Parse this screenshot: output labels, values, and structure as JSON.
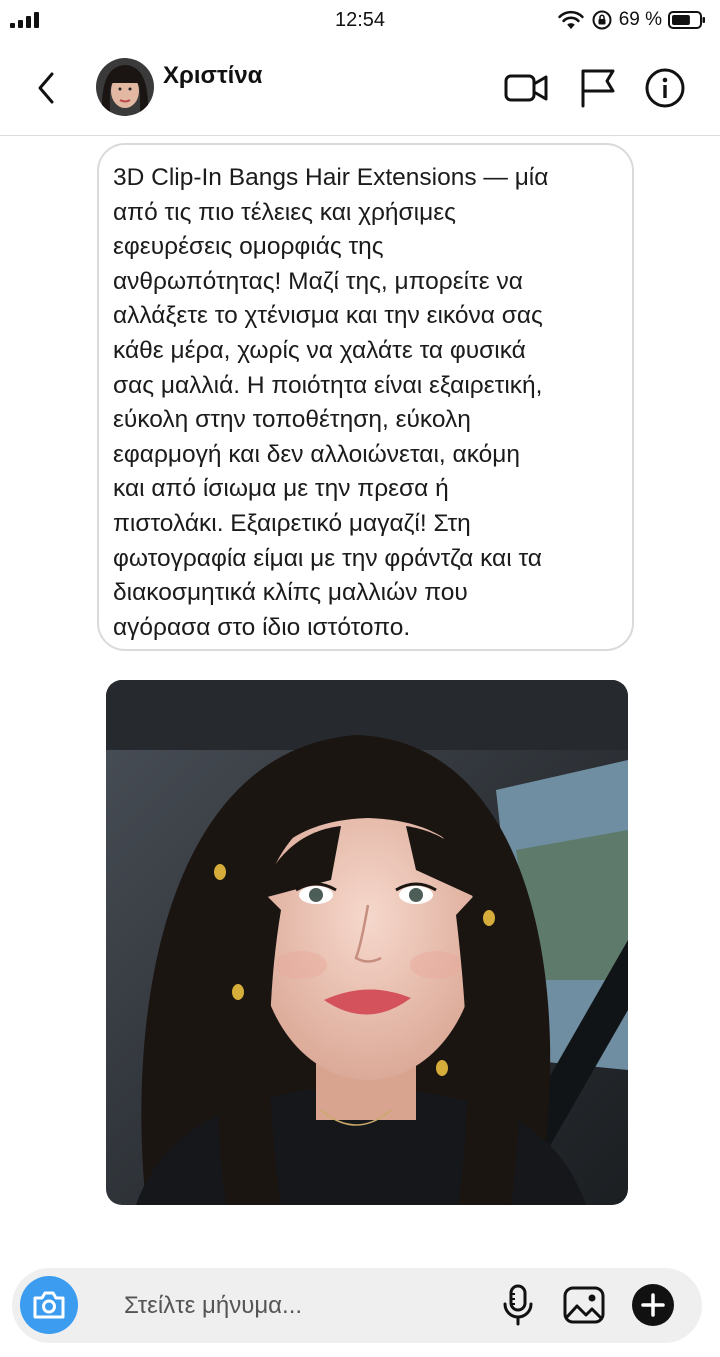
{
  "status_bar": {
    "time": "12:54",
    "battery_percent": "69 %",
    "battery_level": 0.69,
    "icons": [
      "signal-icon",
      "wifi-icon",
      "rotation-lock-icon",
      "battery-icon"
    ]
  },
  "header": {
    "contact_name": "Χριστίνα",
    "icons": [
      "back-icon",
      "video-call-icon",
      "flag-icon",
      "info-icon"
    ]
  },
  "message": {
    "text": "3D Clip-In Bangs Hair Extensions — μία\nαπό τις πιο τέλειες και χρήσιμες\nεφευρέσεις ομορφιάς της\nανθρωπότητας! Μαζί της, μπορείτε να\nαλλάξετε το χτένισμα και την εικόνα σας\nκάθε μέρα, χωρίς να χαλάτε τα φυσικά\nσας μαλλιά. Η ποιότητα είναι εξαιρετική,\nεύκολη στην τοποθέτηση, εύκολη\nεφαρμογή και δεν αλλοιώνεται, ακόμη\nκαι από ίσιωμα με την πρεσα ή\nπιστολάκι. Εξαιρετικό μαγαζί! Στη\nφωτογραφία είμαι με την φράντζα και τα\nδιακοσμητικά κλίπς μαλλιών που\nαγόρασα στο ίδιο ιστότοπο."
  },
  "composer": {
    "placeholder": "Στείλτε μήνυμα...",
    "icons": [
      "camera-icon",
      "microphone-icon",
      "gallery-icon",
      "add-icon"
    ]
  },
  "colors": {
    "camera_button": "#3b9cf0",
    "bubble_border": "#dadada",
    "composer_bg": "#efefef"
  }
}
